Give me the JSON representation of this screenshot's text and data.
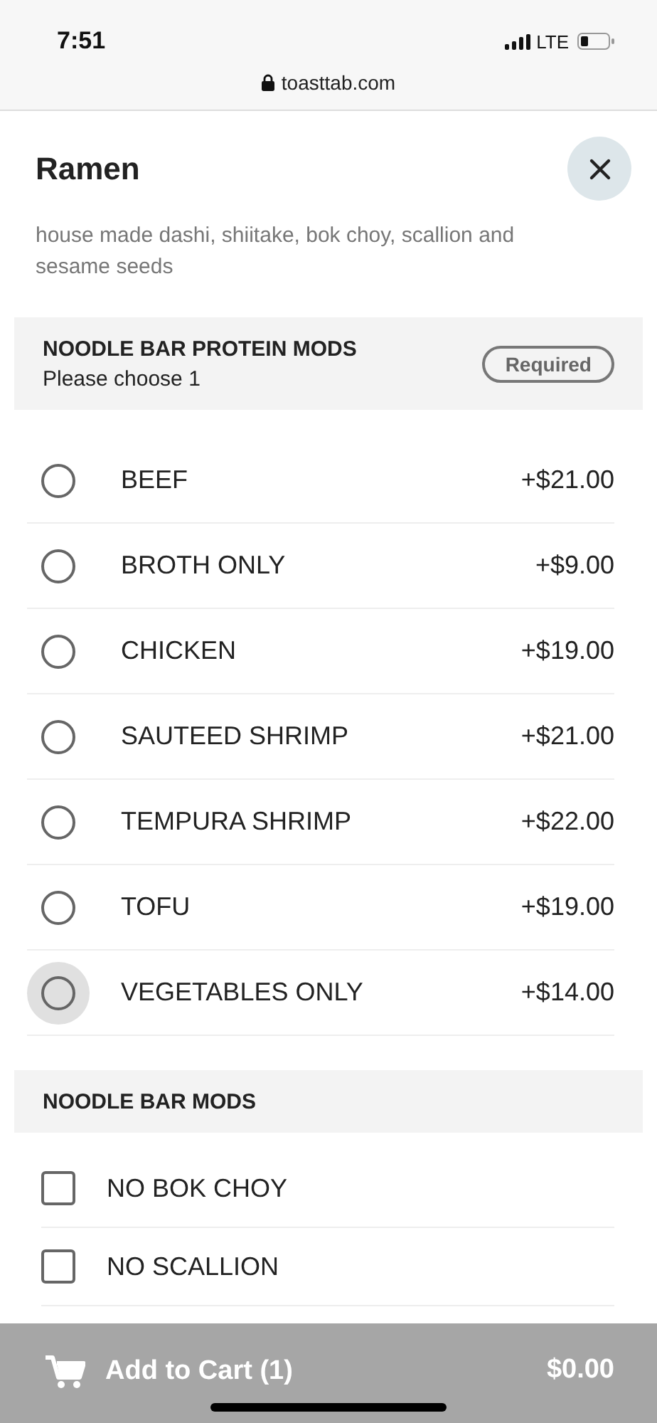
{
  "status_bar": {
    "time": "7:51",
    "network": "LTE"
  },
  "browser": {
    "url": "toasttab.com"
  },
  "item": {
    "title": "Ramen",
    "description": "house made dashi, shiitake, bok choy, scallion and sesame seeds"
  },
  "groups": [
    {
      "title": "NOODLE BAR PROTEIN MODS",
      "subtitle": "Please choose 1",
      "badge": "Required",
      "kind": "radio",
      "options": [
        {
          "label": "BEEF",
          "price": "+$21.00",
          "selected": false,
          "highlighted": false
        },
        {
          "label": "BROTH ONLY",
          "price": "+$9.00",
          "selected": false,
          "highlighted": false
        },
        {
          "label": "CHICKEN",
          "price": "+$19.00",
          "selected": false,
          "highlighted": false
        },
        {
          "label": "SAUTEED SHRIMP",
          "price": "+$21.00",
          "selected": false,
          "highlighted": false
        },
        {
          "label": "TEMPURA SHRIMP",
          "price": "+$22.00",
          "selected": false,
          "highlighted": false
        },
        {
          "label": "TOFU",
          "price": "+$19.00",
          "selected": false,
          "highlighted": false
        },
        {
          "label": "VEGETABLES ONLY",
          "price": "+$14.00",
          "selected": false,
          "highlighted": true
        }
      ]
    },
    {
      "title": "NOODLE BAR MODS",
      "kind": "checkbox",
      "options": [
        {
          "label": "NO BOK CHOY",
          "checked": false
        },
        {
          "label": "NO SCALLION",
          "checked": false
        }
      ]
    }
  ],
  "cart_button": {
    "label": "Add to Cart (1)",
    "total": "$0.00",
    "disabled": true
  }
}
